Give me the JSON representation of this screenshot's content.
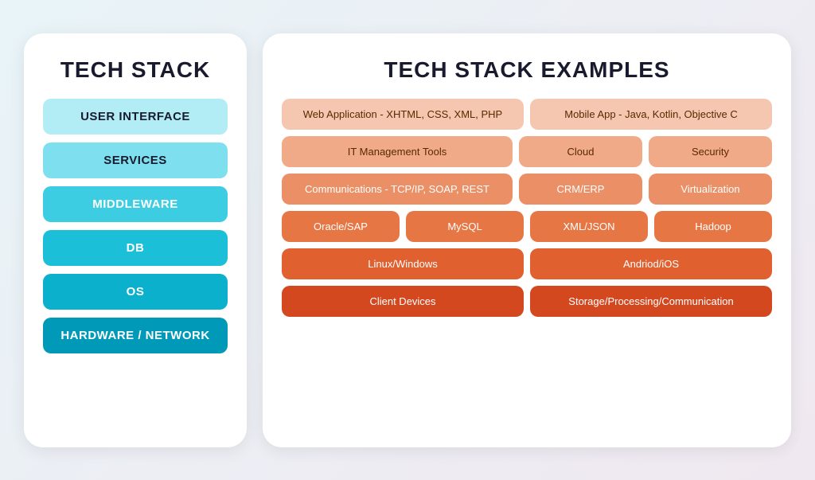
{
  "left_panel": {
    "title": "TECH STACK",
    "items": [
      {
        "label": "USER INTERFACE",
        "class": "ui"
      },
      {
        "label": "SERVICES",
        "class": "services"
      },
      {
        "label": "MIDDLEWARE",
        "class": "middleware"
      },
      {
        "label": "DB",
        "class": "db"
      },
      {
        "label": "OS",
        "class": "os"
      },
      {
        "label": "HARDWARE / NETWORK",
        "class": "hardware"
      }
    ]
  },
  "right_panel": {
    "title": "TECH STACK EXAMPLES",
    "rows": [
      {
        "color": "color-1",
        "cells": [
          {
            "label": "Web Application - XHTML, CSS, XML, PHP",
            "flex": "flex-1"
          },
          {
            "label": "Mobile App - Java, Kotlin, Objective C",
            "flex": "flex-1"
          }
        ]
      },
      {
        "color": "color-2",
        "cells": [
          {
            "label": "IT Management Tools",
            "flex": "flex-2"
          },
          {
            "label": "Cloud",
            "flex": "flex-1"
          },
          {
            "label": "Security",
            "flex": "flex-1"
          }
        ]
      },
      {
        "color": "color-3",
        "cells": [
          {
            "label": "Communications - TCP/IP, SOAP, REST",
            "flex": "flex-2"
          },
          {
            "label": "CRM/ERP",
            "flex": "flex-1"
          },
          {
            "label": "Virtualization",
            "flex": "flex-1"
          }
        ]
      },
      {
        "color": "color-4",
        "cells": [
          {
            "label": "Oracle/SAP",
            "flex": "flex-1"
          },
          {
            "label": "MySQL",
            "flex": "flex-1"
          },
          {
            "label": "XML/JSON",
            "flex": "flex-1"
          },
          {
            "label": "Hadoop",
            "flex": "flex-1"
          }
        ]
      },
      {
        "color": "color-5",
        "cells": [
          {
            "label": "Linux/Windows",
            "flex": "flex-1"
          },
          {
            "label": "Andriod/iOS",
            "flex": "flex-1"
          }
        ]
      },
      {
        "color": "color-6",
        "cells": [
          {
            "label": "Client Devices",
            "flex": "flex-1"
          },
          {
            "label": "Storage/Processing/Communication",
            "flex": "flex-1"
          }
        ]
      }
    ]
  }
}
